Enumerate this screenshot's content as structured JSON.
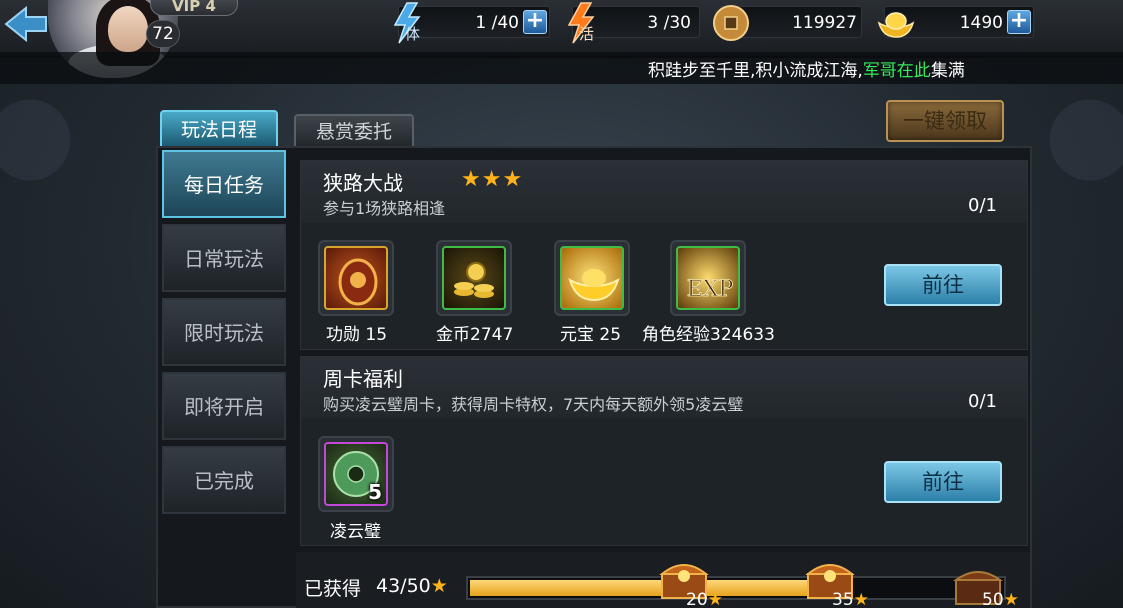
{
  "player": {
    "vip_label": "VIP 4",
    "level": "72"
  },
  "resources": {
    "energy": {
      "label": "体",
      "value": "1 /40"
    },
    "vigor": {
      "label": "活",
      "value": "3 /30"
    },
    "coins": {
      "value": "119927"
    },
    "gold": {
      "value": "1490"
    }
  },
  "marquee": {
    "text_before": "积跬步至千里,积小流成江海,",
    "highlight": "军哥在此",
    "text_after": "集满"
  },
  "tabs": [
    {
      "label": "玩法日程",
      "active": true
    },
    {
      "label": "悬赏委托",
      "active": false
    }
  ],
  "claim_all_label": "一键领取",
  "sidebar": [
    {
      "label": "每日任务",
      "active": true
    },
    {
      "label": "日常玩法",
      "active": false
    },
    {
      "label": "限时玩法",
      "active": false
    },
    {
      "label": "即将开启",
      "active": false
    },
    {
      "label": "已完成",
      "active": false
    }
  ],
  "tasks": [
    {
      "title": "狭路大战",
      "stars": "★★★",
      "desc": "参与1场狭路相逢",
      "progress": "0/1",
      "go_label": "前往",
      "rewards": [
        {
          "icon": "merit-token-icon",
          "label": "功勋 15"
        },
        {
          "icon": "gold-coins-icon",
          "label": "金币2747"
        },
        {
          "icon": "ingot-icon",
          "label": "元宝 25"
        },
        {
          "icon": "exp-icon",
          "label": "角色经验324633",
          "icon_text": "EXP"
        }
      ]
    },
    {
      "title": "周卡福利",
      "desc": "购买凌云璧周卡，获得周卡特权，7天内每天额外领5凌云璧",
      "progress": "0/1",
      "go_label": "前往",
      "rewards": [
        {
          "icon": "jade-disc-icon",
          "label": "凌云璧",
          "count": "5"
        }
      ]
    }
  ],
  "progress": {
    "label": "已获得",
    "value": "43/50",
    "current": 43,
    "max": 50,
    "milestones": [
      {
        "label": "20",
        "value": 20
      },
      {
        "label": "35",
        "value": 35
      },
      {
        "label": "50",
        "value": 50
      }
    ]
  },
  "colors": {
    "accent_blue": "#5fc4e4",
    "star": "#ffb21a",
    "highlight_green": "#39e85c",
    "progress_fill": "#e6a21c"
  }
}
